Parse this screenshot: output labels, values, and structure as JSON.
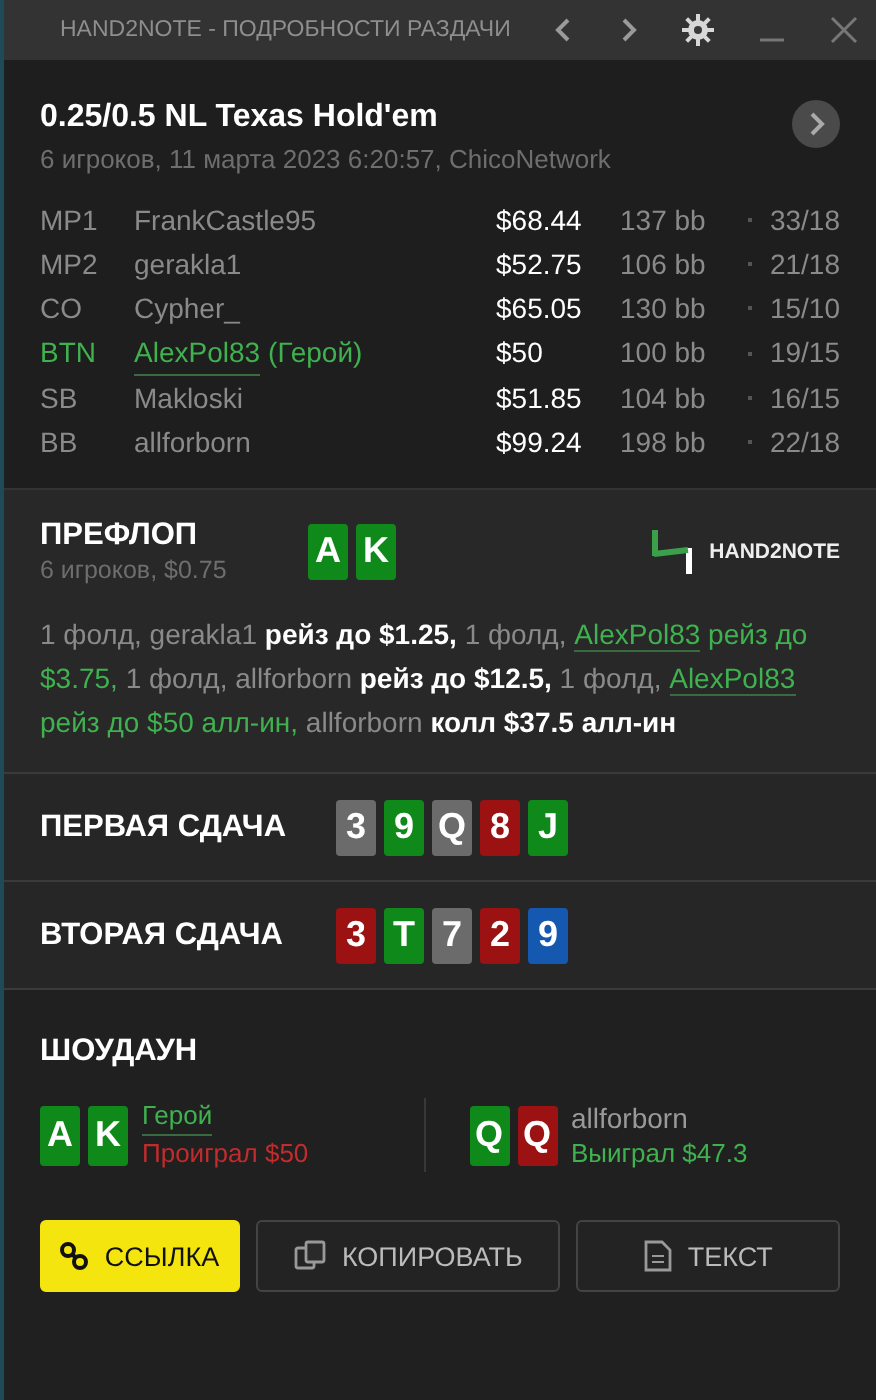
{
  "window": {
    "title": "HAND2NOTE - ПОДРОБНОСТИ РАЗДАЧИ"
  },
  "hand": {
    "title": "0.25/0.5 NL Texas Hold'em",
    "subtitle": "6 игроков, 11 марта 2023 6:20:57, ChicoNetwork"
  },
  "players": [
    {
      "position": "MP1",
      "name": "FrankCastle95",
      "hero": false,
      "stack": "$68.44",
      "bb": "137 bb",
      "stats": "33/18"
    },
    {
      "position": "MP2",
      "name": "gerakla1",
      "hero": false,
      "stack": "$52.75",
      "bb": "106 bb",
      "stats": "21/18"
    },
    {
      "position": "CO",
      "name": "Cypher_",
      "hero": false,
      "stack": "$65.05",
      "bb": "130 bb",
      "stats": "15/10"
    },
    {
      "position": "BTN",
      "name": "AlexPol83",
      "hero_label": "(Герой)",
      "hero": true,
      "stack": "$50",
      "bb": "100 bb",
      "stats": "19/15"
    },
    {
      "position": "SB",
      "name": "Makloski",
      "hero": false,
      "stack": "$51.85",
      "bb": "104 bb",
      "stats": "16/15"
    },
    {
      "position": "BB",
      "name": "allforborn",
      "hero": false,
      "stack": "$99.24",
      "bb": "198 bb",
      "stats": "22/18"
    }
  ],
  "preflop": {
    "title": "ПРЕФЛОП",
    "subtitle": "6 игроков, $0.75",
    "logo": "HAND2NOTE",
    "cards": [
      {
        "rank": "A",
        "color": "#0f8a1a"
      },
      {
        "rank": "K",
        "color": "#0f8a1a"
      }
    ],
    "actions": [
      {
        "text": "1 фолд, gerakla1 ",
        "kind": "muted"
      },
      {
        "text": "рейз до $1.25,",
        "kind": "action"
      },
      {
        "text": " 1 фолд, ",
        "kind": "muted"
      },
      {
        "text": "AlexPol83",
        "kind": "hero-link"
      },
      {
        "text": " рейз до $3.75,",
        "kind": "hero"
      },
      {
        "text": " 1 фолд, allforborn ",
        "kind": "muted"
      },
      {
        "text": "рейз до $12.5,",
        "kind": "action"
      },
      {
        "text": " 1 фолд, ",
        "kind": "muted"
      },
      {
        "text": "AlexPol83",
        "kind": "hero-link"
      },
      {
        "text": " рейз до $50 алл-ин,",
        "kind": "hero"
      },
      {
        "text": " allforborn ",
        "kind": "muted"
      },
      {
        "text": "колл $37.5 алл-ин",
        "kind": "action"
      }
    ]
  },
  "boards": [
    {
      "title": "ПЕРВАЯ СДАЧА",
      "cards": [
        {
          "rank": "3",
          "color": "#6b6b6b"
        },
        {
          "rank": "9",
          "color": "#0f8a1a"
        },
        {
          "rank": "Q",
          "color": "#6b6b6b"
        },
        {
          "rank": "8",
          "color": "#9c1111"
        },
        {
          "rank": "J",
          "color": "#0f8a1a"
        }
      ]
    },
    {
      "title": "ВТОРАЯ СДАЧА",
      "cards": [
        {
          "rank": "3",
          "color": "#9c1111"
        },
        {
          "rank": "T",
          "color": "#0f8a1a"
        },
        {
          "rank": "7",
          "color": "#6b6b6b"
        },
        {
          "rank": "2",
          "color": "#9c1111"
        },
        {
          "rank": "9",
          "color": "#1558b0"
        }
      ]
    }
  ],
  "showdown": {
    "title": "ШОУДАУН",
    "hands": [
      {
        "cards": [
          {
            "rank": "A",
            "color": "#0f8a1a"
          },
          {
            "rank": "K",
            "color": "#0f8a1a"
          }
        ],
        "name": "Герой",
        "hero": true,
        "result": "Проиграл $50",
        "won": false
      },
      {
        "cards": [
          {
            "rank": "Q",
            "color": "#0f8a1a"
          },
          {
            "rank": "Q",
            "color": "#9c1111"
          }
        ],
        "name": "allforborn",
        "hero": false,
        "result": "Выиграл $47.3",
        "won": true
      }
    ]
  },
  "buttons": [
    {
      "label": "ССЫЛКА",
      "kind": "link",
      "selected": true
    },
    {
      "label": "КОПИРОВАТЬ",
      "kind": "copy",
      "selected": false
    },
    {
      "label": "ТЕКСТ",
      "kind": "text",
      "selected": false
    }
  ]
}
